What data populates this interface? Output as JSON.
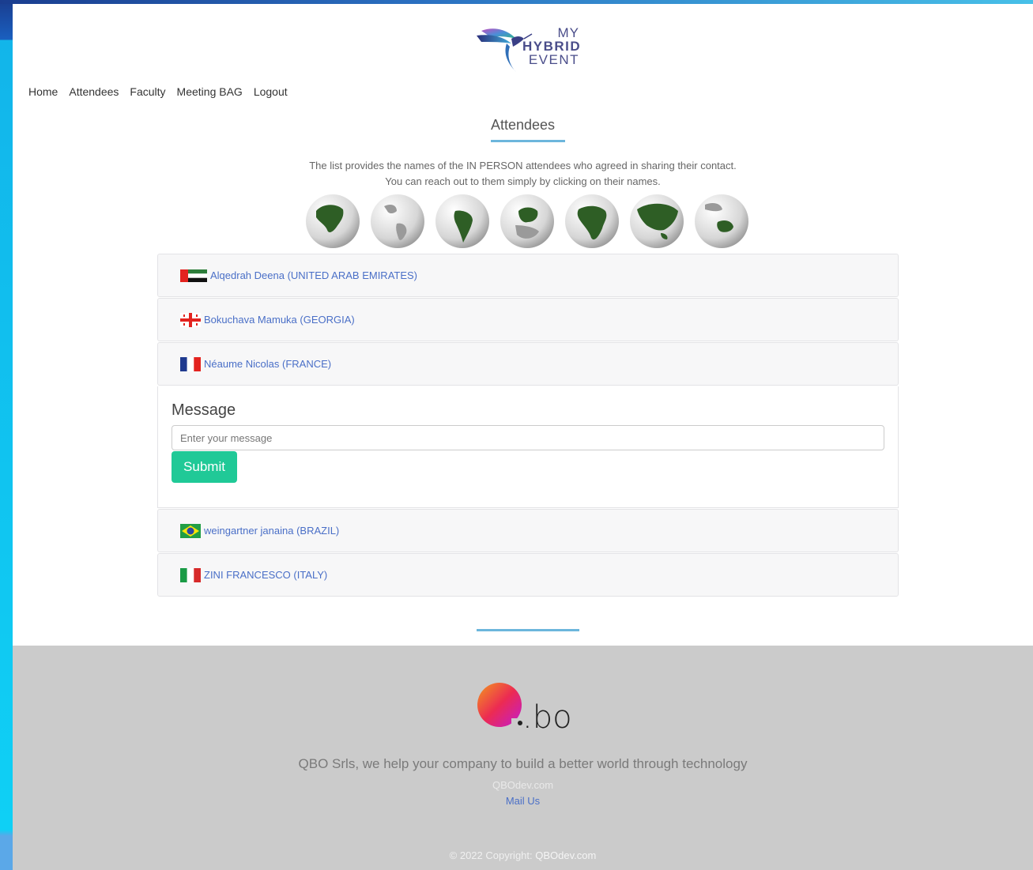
{
  "brand": {
    "logo_line1": "MY",
    "logo_line2": "HYBRID",
    "logo_line3": "EVENT",
    "accent_color": "#6cb6dc"
  },
  "nav": {
    "items": [
      "Home",
      "Attendees",
      "Faculty",
      "Meeting BAG",
      "Logout"
    ]
  },
  "main": {
    "title": "Attendees",
    "intro_line1": "The list provides the names of the IN PERSON attendees who agreed in sharing their contact.",
    "intro_line2": "You can reach out to them simply by clicking on their names.",
    "globes": [
      "north-america-globe",
      "south-america-globe",
      "latin-america-globe",
      "europe-globe",
      "africa-globe",
      "asia-globe",
      "oceania-globe"
    ],
    "attendees": [
      {
        "name": "Alqedrah Deena (UNITED ARAB EMIRATES)",
        "flag": "uae-flag"
      },
      {
        "name": "Bokuchava Mamuka (GEORGIA)",
        "flag": "georgia-flag"
      },
      {
        "name": "Néaume Nicolas (FRANCE)",
        "flag": "france-flag"
      },
      {
        "name": "weingartner janaina (BRAZIL)",
        "flag": "brazil-flag"
      },
      {
        "name": "ZINI FRANCESCO (ITALY)",
        "flag": "italy-flag"
      }
    ],
    "message": {
      "label": "Message",
      "placeholder": "Enter your message",
      "value": "",
      "submit_label": "Submit",
      "submit_color": "#20c997"
    }
  },
  "footer": {
    "logo_text": ".bo",
    "tagline": "QBO Srls, we help your company to build a better world through technology",
    "site_link": "QBOdev.com",
    "mail_link": "Mail Us",
    "copyright_prefix": "© 2022 Copyright:",
    "copyright_link": "QBOdev.com",
    "background": "#cbcbcb"
  }
}
